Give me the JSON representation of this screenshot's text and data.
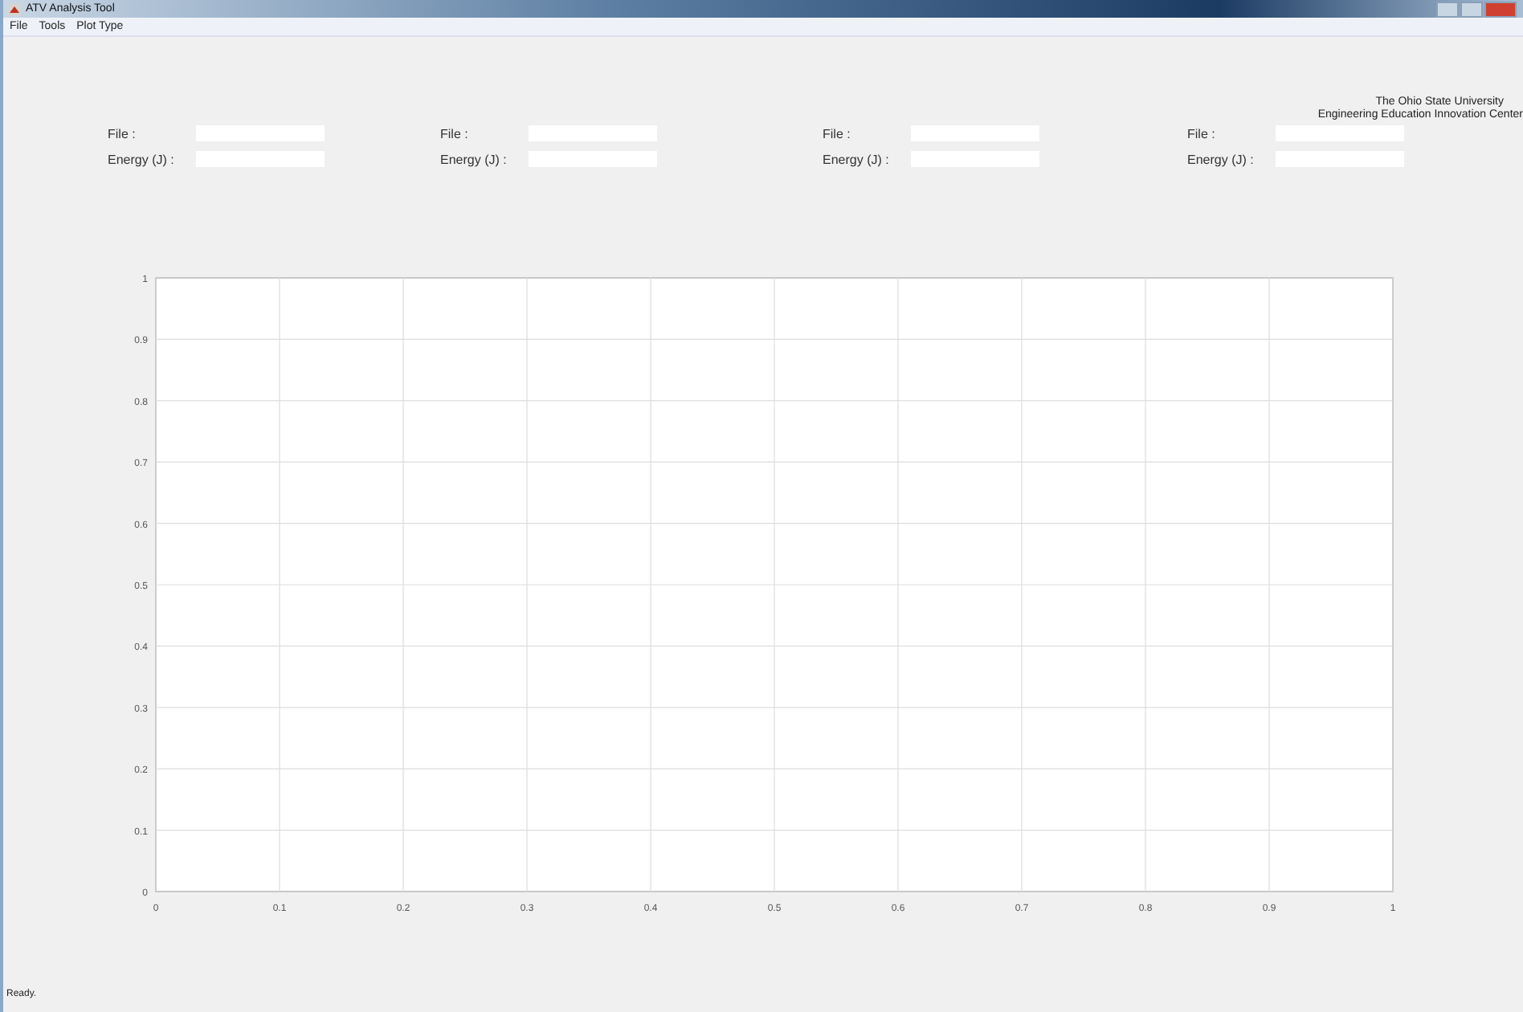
{
  "window": {
    "title": "ATV Analysis Tool"
  },
  "menu": [
    "File",
    "Tools",
    "Plot Type"
  ],
  "credit": [
    "The Ohio State University",
    "Engineering Education Innovation Center"
  ],
  "file_groups": [
    {
      "file_label": "File :",
      "energy_label": "Energy (J) :"
    },
    {
      "file_label": "File :",
      "energy_label": "Energy (J) :"
    },
    {
      "file_label": "File :",
      "energy_label": "Energy (J) :"
    },
    {
      "file_label": "File :",
      "energy_label": "Energy (J) :"
    }
  ],
  "plot": {
    "chart_data": {
      "type": "line",
      "xlim": [
        0,
        1
      ],
      "ylim": [
        0,
        1
      ],
      "xticks": [
        0,
        0.1,
        0.2,
        0.3,
        0.4,
        0.5,
        0.6,
        0.7,
        0.8,
        0.9,
        1
      ],
      "yticks": [
        0,
        0.1,
        0.2,
        0.3,
        0.4,
        0.5,
        0.6,
        0.7,
        0.8,
        0.9,
        1
      ],
      "grid": true
    }
  },
  "status_bar": "Ready."
}
